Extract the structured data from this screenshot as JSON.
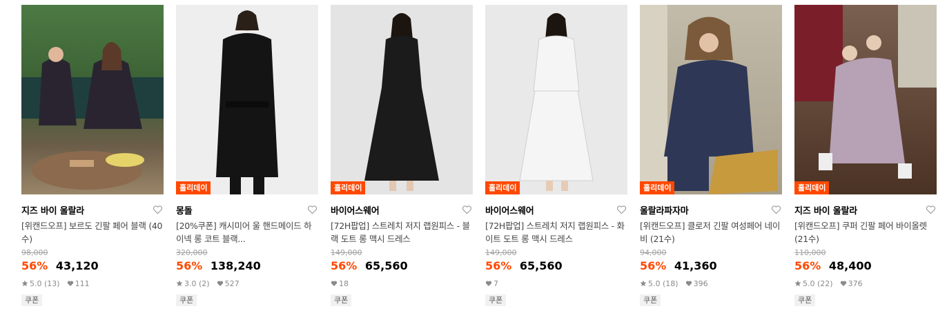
{
  "products": [
    {
      "brand": "지즈 바이 울랄라",
      "title": "[위캔드오프] 보르도 긴팔 페어 블랙 (40수)",
      "original_price": "98,000",
      "discount": "56%",
      "price": "43,120",
      "badge": "",
      "rating": "5.0",
      "review_count": "(13)",
      "likes": "111",
      "coupon": "쿠폰",
      "colors": {
        "bg_top": "#3f6b3a",
        "bg_bottom": "#6a7d55",
        "garment": "#2a2430"
      }
    },
    {
      "brand": "몽돌",
      "title": "[20%쿠폰] 캐시미어 울 핸드메이드 하이넥 롱 코트 블랙...",
      "original_price": "320,000",
      "discount": "56%",
      "price": "138,240",
      "badge": "홀리데이",
      "rating": "3.0",
      "review_count": "(2)",
      "likes": "527",
      "coupon": "쿠폰",
      "colors": {
        "bg_top": "#efefef",
        "bg_bottom": "#e5e5e5",
        "garment": "#151515"
      }
    },
    {
      "brand": "바이어스웨어",
      "title": "[72H팝업] 스트레치 저지 랩원피스 - 블랙 도트 롱 맥시 드레스",
      "original_price": "149,000",
      "discount": "56%",
      "price": "65,560",
      "badge": "홀리데이",
      "rating": "",
      "review_count": "",
      "likes": "18",
      "coupon": "쿠폰",
      "colors": {
        "bg_top": "#e6e6e6",
        "bg_bottom": "#dcdcdc",
        "garment": "#1a1a1a"
      }
    },
    {
      "brand": "바이어스웨어",
      "title": "[72H팝업] 스트레치 저지 랩원피스 - 화이트 도트 롱 맥시 드레스",
      "original_price": "149,000",
      "discount": "56%",
      "price": "65,560",
      "badge": "홀리데이",
      "rating": "",
      "review_count": "",
      "likes": "7",
      "coupon": "쿠폰",
      "colors": {
        "bg_top": "#ececec",
        "bg_bottom": "#e2e2e2",
        "garment": "#f4f4f4"
      }
    },
    {
      "brand": "울랄라파자마",
      "title": "[위캔드오프] 클로저 긴팔 여성페어 네이비 (21수)",
      "original_price": "94,000",
      "discount": "56%",
      "price": "41,360",
      "badge": "홀리데이",
      "rating": "5.0",
      "review_count": "(18)",
      "likes": "396",
      "coupon": "쿠폰",
      "colors": {
        "bg_top": "#b9b2a3",
        "bg_bottom": "#a69c88",
        "garment": "#2b3350"
      }
    },
    {
      "brand": "지즈 바이 울랄라",
      "title": "[위캔드오프] 쿠퍼 긴팔 페어 바이올렛 (21수)",
      "original_price": "110,000",
      "discount": "56%",
      "price": "48,400",
      "badge": "홀리데이",
      "rating": "5.0",
      "review_count": "(22)",
      "likes": "376",
      "coupon": "쿠폰",
      "colors": {
        "bg_top": "#6a5040",
        "bg_bottom": "#4e3628",
        "garment": "#b9a3b6"
      }
    }
  ],
  "ui": {
    "accent": "#ff4800",
    "icons": {
      "like": "heart-outline-icon",
      "star": "star-icon",
      "likes": "heart-filled-icon"
    }
  }
}
